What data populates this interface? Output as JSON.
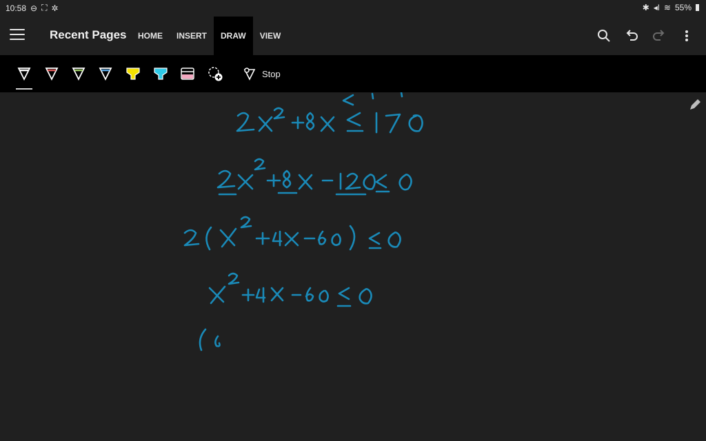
{
  "status": {
    "time": "10:58",
    "battery": "55%"
  },
  "app": {
    "title": "Recent Pages",
    "tabs": [
      {
        "label": "HOME"
      },
      {
        "label": "INSERT"
      },
      {
        "label": "DRAW",
        "active": true
      },
      {
        "label": "VIEW"
      }
    ]
  },
  "ribbon": {
    "pens": [
      {
        "name": "pen-white",
        "color": "#ffffff",
        "selected": true
      },
      {
        "name": "pen-red",
        "color": "#e05a5a"
      },
      {
        "name": "pen-green",
        "color": "#9ccc65"
      },
      {
        "name": "pen-blue",
        "color": "#5aa9e6"
      },
      {
        "name": "highlighter-yellow",
        "color": "#f5e100"
      },
      {
        "name": "highlighter-cyan",
        "color": "#2ec9e6"
      },
      {
        "name": "highlighter-pink",
        "color": "#f3a8c0"
      }
    ],
    "stop_label": "Stop"
  },
  "ink_color": "#1a8ab8"
}
